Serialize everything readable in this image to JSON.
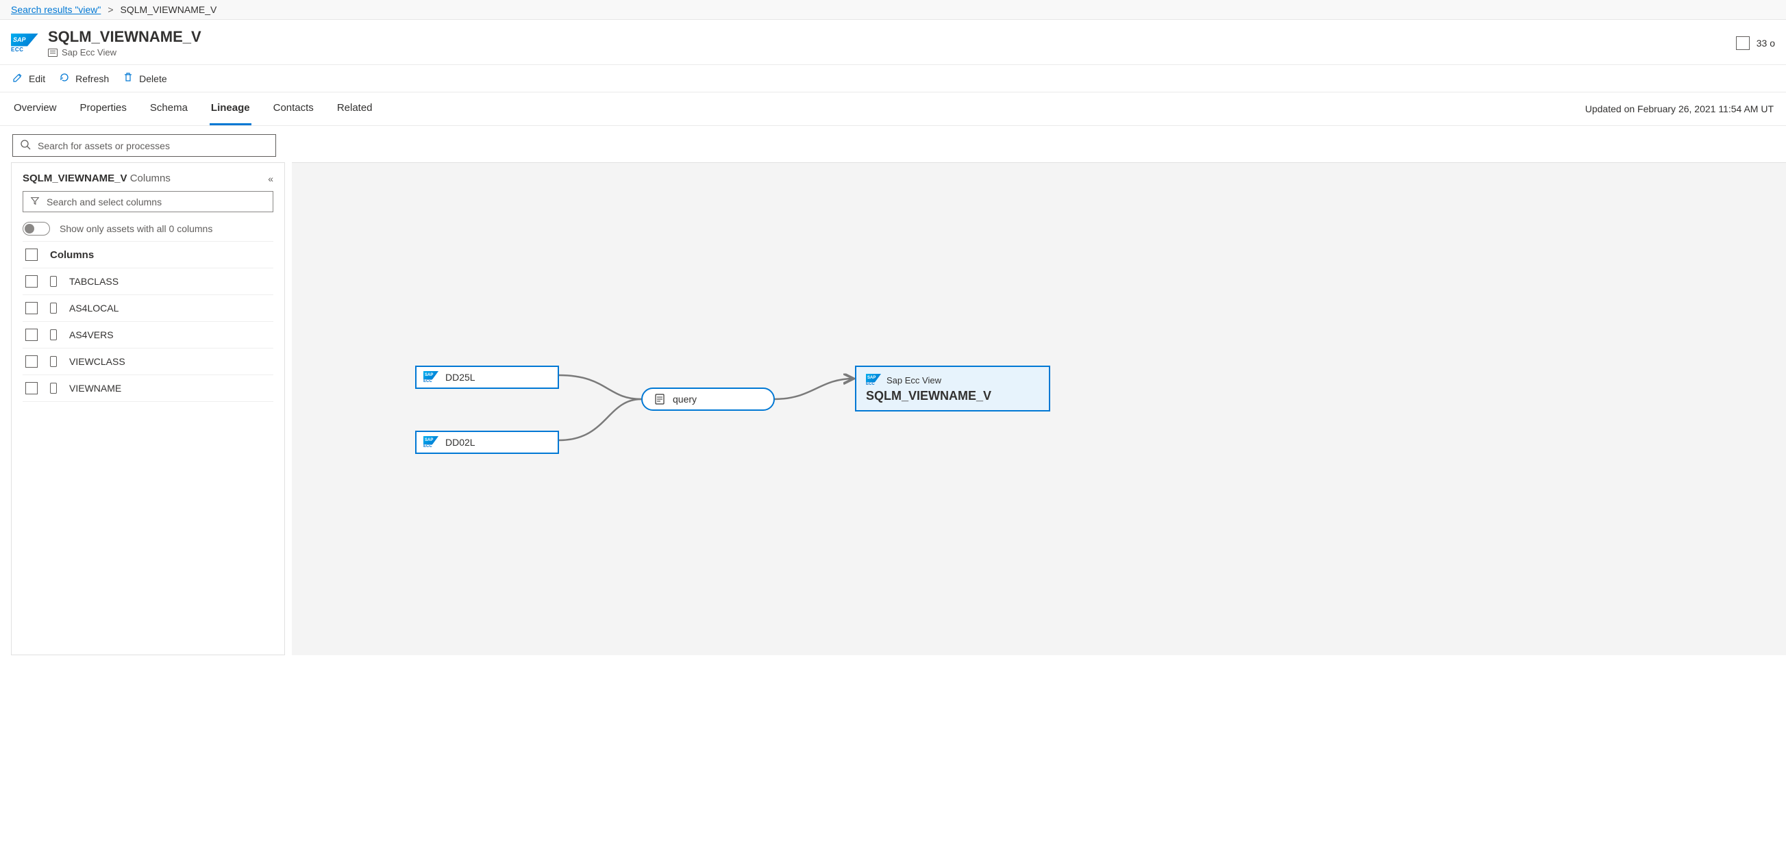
{
  "breadcrumb": {
    "link_label": "Search results \"view\"",
    "current": "SQLM_VIEWNAME_V"
  },
  "header": {
    "title": "SQLM_VIEWNAME_V",
    "subtitle": "Sap Ecc View",
    "right_count": "33 o"
  },
  "toolbar": {
    "edit": "Edit",
    "refresh": "Refresh",
    "delete": "Delete"
  },
  "tabs": {
    "overview": "Overview",
    "properties": "Properties",
    "schema": "Schema",
    "lineage": "Lineage",
    "contacts": "Contacts",
    "related": "Related"
  },
  "updated_text": "Updated on February 26, 2021 11:54 AM UT",
  "search": {
    "placeholder": "Search for assets or processes"
  },
  "side": {
    "title_bold": "SQLM_VIEWNAME_V",
    "title_muted": "Columns",
    "column_search_placeholder": "Search and select columns",
    "toggle_label": "Show only assets with all 0 columns",
    "columns_header": "Columns",
    "columns": [
      "TABCLASS",
      "AS4LOCAL",
      "AS4VERS",
      "VIEWCLASS",
      "VIEWNAME"
    ]
  },
  "lineage": {
    "source1": "DD25L",
    "source2": "DD02L",
    "process": "query",
    "sink_label": "Sap Ecc View",
    "sink_title": "SQLM_VIEWNAME_V"
  }
}
